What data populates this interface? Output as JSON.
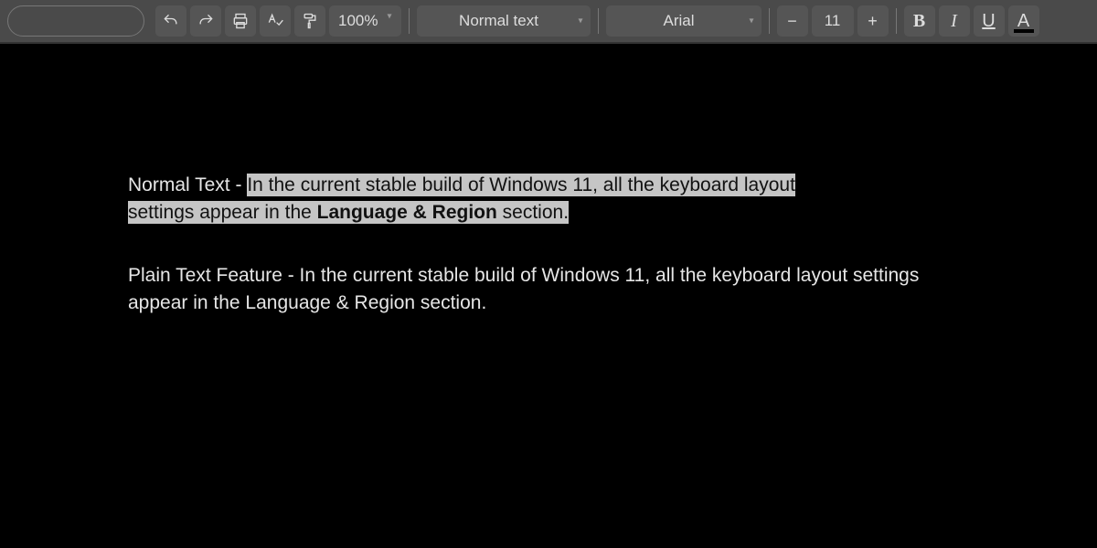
{
  "toolbar": {
    "zoom": "100%",
    "style": "Normal text",
    "font": "Arial",
    "font_size": "11",
    "bold_label": "B",
    "italic_label": "I",
    "underline_label": "U",
    "textcolor_label": "A",
    "minus": "−",
    "plus": "+"
  },
  "document": {
    "p1_prefix": "Normal Text - ",
    "p1_sel_a": "In the current stable build of Windows 11, all the keyboard layout ",
    "p1_sel_b1": "settings appear in the ",
    "p1_sel_strong": "Language & Region",
    "p1_sel_b2": " section.",
    "p2": "Plain Text Feature - In the current stable build of Windows 11, all the keyboard layout settings appear in the Language & Region section."
  }
}
